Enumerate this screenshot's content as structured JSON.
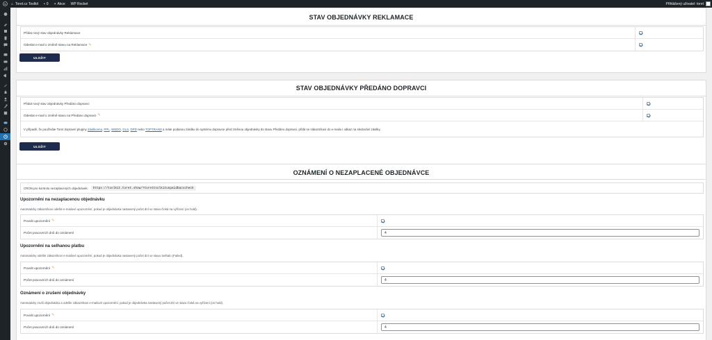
{
  "adminbar": {
    "site_name": "Toret.cz Toolkit",
    "comments_count": "0",
    "new_label": "Akce",
    "plugin_label": "WP Rocket",
    "user_label": "Přihlášený uživatel: toret"
  },
  "sidebar": {
    "icons": [
      "dashboard-icon",
      "pin-icon",
      "media-icon",
      "pages-icon",
      "comments-icon",
      "woocommerce-icon",
      "products-icon",
      "analytics-icon",
      "marketing-icon",
      "appearance-icon",
      "plugins-icon",
      "users-icon",
      "tools-icon",
      "settings-icon",
      "toret-icon",
      "circle-icon",
      "clock-icon",
      "gear-icon"
    ],
    "active_index": 16
  },
  "reklamace": {
    "title": "STAV OBJEDNÁVKY REKLAMACE",
    "rows": [
      {
        "label": "Přidat nový stav objednávky Reklamace",
        "checked": true
      },
      {
        "label": "Odeslat e-mail o změně stavu na Reklamace",
        "checked": true
      }
    ],
    "save": "ULOŽIT"
  },
  "predano": {
    "title": "STAV OBJEDNÁVKY PŘEDÁNO DOPRAVCI",
    "rows": [
      {
        "label": "Přidat nový stav objednávky Předáno dopravci",
        "checked": true
      },
      {
        "label": "Odeslat e-mail o změně stavu na Předáno dopravci",
        "checked": true
      }
    ],
    "note_prefix": "V případě, že používáte Toret dopravní pluginy",
    "links": [
      "Zásilkovna",
      "PPL",
      "WEDO",
      "GLS",
      "DPD"
    ],
    "link_sep": ", ",
    "link_or": "nebo",
    "link_last": "TOPTRANS",
    "note_suffix": "a máte podanou zásilku do systému dopravce před změnou objednávky do stavu Předáno dopravci, přidá se zákazníkovi do e-mailu i odkaz na sledování zásilky.",
    "save": "ULOŽIT"
  },
  "nezaplacene": {
    "title": "OZNÁMENÍ O NEZAPLACENÉ OBJEDNÁVCE",
    "cron_label": "CRON pro kontrolu nezaplacených objednávek:",
    "cron_url": "https://toolkit.toret.show/?torettoolkitunpaidbacocheck",
    "sections": [
      {
        "heading": "Upozornění na nezaplacenou objednávku",
        "desc": "Automaticky zákazníkovi odešle e-mailové upozornění, pokud je objednávka nastavený počet dní ve stavu Čeká na vyřízení (on hold).",
        "enable_label": "Povolit upozornění",
        "enabled": true,
        "days_label": "Počet pracovních dnů do oznámení",
        "days_value": "4"
      },
      {
        "heading": "Upozornění na selhanou platbu",
        "desc": "Automaticky odešle zákazníkovi e-mailové upozornění, pokud je objednávka nastavený počet dní ve stavu Selhalo (Failed).",
        "enable_label": "Povolit upozornění",
        "enabled": true,
        "days_label": "Počet pracovních dnů do oznámení",
        "days_value": "4"
      },
      {
        "heading": "Oznámení o zrušení objednávky",
        "desc": "Automaticky zruší objednávku a odešle zákazníkovi e-mailové upozornění, pokud je objednávka nastavený počet dní ve stavu Čeká na vyřízení (on hold).",
        "enable_label": "Povolit upozornění",
        "enabled": true,
        "days_label": "Počet pracovních dnů do oznámení",
        "days_value": "4"
      }
    ]
  }
}
